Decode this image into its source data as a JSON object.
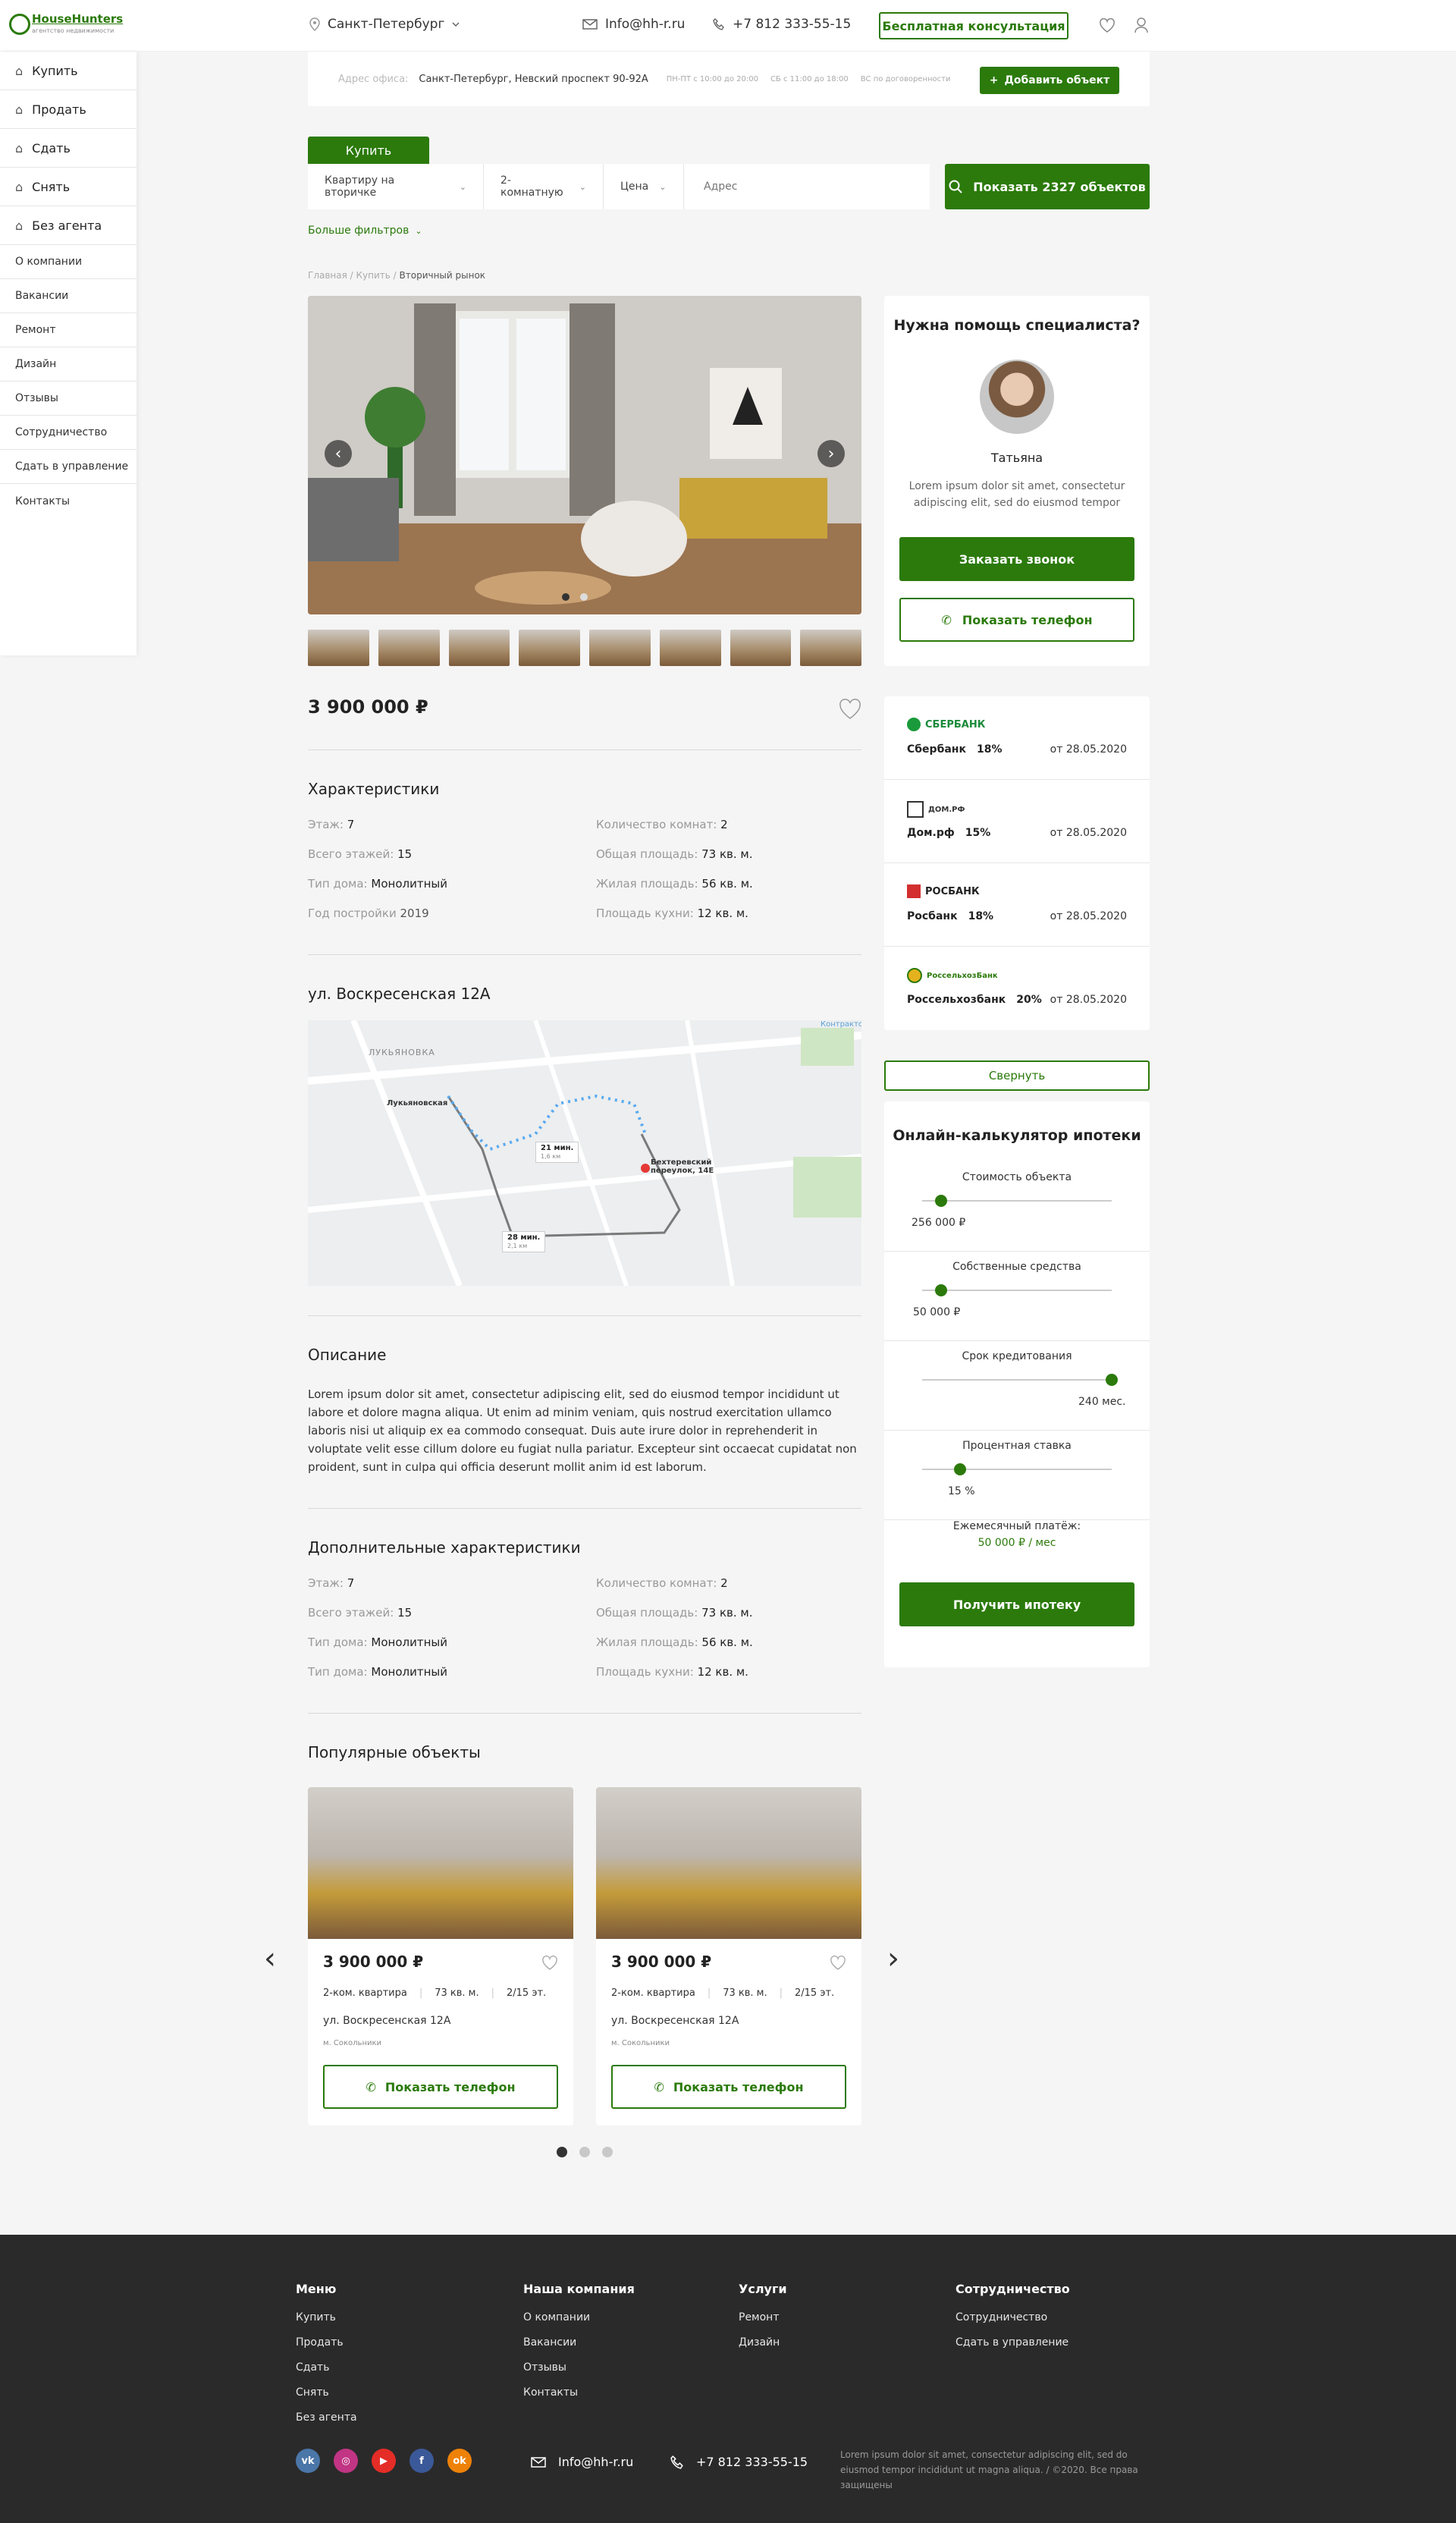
{
  "brand": {
    "name": "HouseHunters",
    "tagline": "агентство недвижимости"
  },
  "header": {
    "city": "Санкт-Петербург",
    "email": "Info@hh-r.ru",
    "phone": "+7 812 333-55-15",
    "consult_button": "Бесплатная консультация"
  },
  "sidebar": {
    "main": [
      {
        "label": "Купить"
      },
      {
        "label": "Продать"
      },
      {
        "label": "Сдать"
      },
      {
        "label": "Снять"
      },
      {
        "label": "Без агента"
      }
    ],
    "sub": [
      {
        "label": "О компании"
      },
      {
        "label": "Вакансии"
      },
      {
        "label": "Ремонт"
      },
      {
        "label": "Дизайн"
      },
      {
        "label": "Отзывы"
      },
      {
        "label": "Сотрудничество"
      },
      {
        "label": "Сдать в управление"
      },
      {
        "label": "Контакты"
      }
    ]
  },
  "office": {
    "label": "Адрес офиса:",
    "address": "Санкт-Петербург, Невский проспект 90-92А",
    "hours": [
      "ПН-ПТ с 10:00 до 20:00",
      "СБ с 11:00 до 18:00",
      "ВС по договоренности"
    ],
    "add_button": "Добавить объект"
  },
  "search": {
    "tab": "Купить",
    "type": "Квартиру на вторичке",
    "rooms": "2-комнатную",
    "price": "Цена",
    "address_placeholder": "Адрес",
    "show_button": "Показать 2327 объектов",
    "more_filters": "Больше фильтров"
  },
  "breadcrumbs": {
    "items": [
      "Главная",
      "Купить"
    ],
    "current": "Вторичный рынок"
  },
  "listing": {
    "price": "3 900 000 ₽",
    "characteristics_title": "Характеристики",
    "characteristics": [
      {
        "k": "Этаж:",
        "v": "7"
      },
      {
        "k": "Количество комнат:",
        "v": "2"
      },
      {
        "k": "Всего этажей:",
        "v": "15"
      },
      {
        "k": "Общая площадь:",
        "v": "73 кв. м."
      },
      {
        "k": "Тип дома:",
        "v": "Монолитный"
      },
      {
        "k": "Жилая площадь:",
        "v": "56 кв. м."
      },
      {
        "k": "Год постройки",
        "v": "2019"
      },
      {
        "k": "Площадь кухни:",
        "v": "12 кв. м."
      }
    ],
    "street_title": "ул. Воскресенская 12А",
    "map": {
      "district": "ЛУКЬЯНОВКА",
      "station": "Лукьяновская",
      "dest": "Бехтеревский переулок, 14Е",
      "route1": "21 мин.",
      "route1_sub": "1,6 км",
      "route2": "28 мин.",
      "route2_sub": "2,1 км",
      "label_kontr": "Контрактова"
    },
    "description_title": "Описание",
    "description": "Lorem ipsum dolor sit amet, consectetur adipiscing elit, sed do eiusmod tempor incididunt ut labore et dolore magna aliqua. Ut enim ad minim veniam, quis nostrud exercitation ullamco laboris nisi ut aliquip ex ea commodo consequat. Duis aute irure dolor in reprehenderit in voluptate velit esse cillum dolore eu fugiat nulla pariatur. Excepteur sint occaecat cupidatat non proident, sunt in culpa qui officia deserunt mollit anim id est laborum.",
    "extra_title": "Дополнительные характеристики",
    "extra": [
      {
        "k": "Этаж:",
        "v": "7"
      },
      {
        "k": "Количество комнат:",
        "v": "2"
      },
      {
        "k": "Всего этажей:",
        "v": "15"
      },
      {
        "k": "Общая площадь:",
        "v": "73 кв. м."
      },
      {
        "k": "Тип дома:",
        "v": "Монолитный"
      },
      {
        "k": "Жилая площадь:",
        "v": "56 кв. м."
      },
      {
        "k": "Тип дома:",
        "v": "Монолитный"
      },
      {
        "k": "Площадь кухни:",
        "v": "12 кв. м."
      }
    ]
  },
  "specialist": {
    "title": "Нужна помощь специалиста?",
    "name": "Татьяна",
    "about": "Lorem ipsum dolor sit amet, consectetur adipiscing elit, sed do eiusmod tempor",
    "call_button": "Заказать звонок",
    "phone_button": "Показать телефон"
  },
  "banks": [
    {
      "logo": "СБЕРБАНК",
      "name": "Сбербанк",
      "rate": "18%",
      "date": "от 28.05.2020"
    },
    {
      "logo": "ДОМ.РФ",
      "name": "Дом.рф",
      "rate": "15%",
      "date": "от 28.05.2020"
    },
    {
      "logo": "РОСБАНК",
      "name": "Росбанк",
      "rate": "18%",
      "date": "от 28.05.2020"
    },
    {
      "logo": "РоссельхозБанк",
      "name": "Россельхозбанк",
      "rate": "20%",
      "date": "от 28.05.2020"
    }
  ],
  "collapse_button": "Свернуть",
  "calculator": {
    "title": "Онлайн-калькулятор ипотеки",
    "sliders": [
      {
        "label": "Стоимость объекта",
        "value": "256 000 ₽",
        "level": 0.1
      },
      {
        "label": "Собственные средства",
        "value": "50 000 ₽",
        "level": 0.1
      },
      {
        "label": "Срок кредитования",
        "value": "240 мес.",
        "level": 1.0
      },
      {
        "label": "Процентная ставка",
        "value": "15 %",
        "level": 0.2
      }
    ],
    "monthly_label": "Ежемесячный платёж:",
    "monthly_value": "50 000 ₽ / мес",
    "get_button": "Получить ипотеку"
  },
  "popular": {
    "title": "Популярные объекты",
    "cards": [
      {
        "price": "3 900 000 ₽",
        "rooms": "2-ком. квартира",
        "area": "73 кв. м.",
        "floor": "2/15 эт.",
        "street": "ул. Воскресенская 12А",
        "metro": "м. Сокольники",
        "button": "Показать телефон"
      },
      {
        "price": "3 900 000 ₽",
        "rooms": "2-ком. квартира",
        "area": "73 кв. м.",
        "floor": "2/15 эт.",
        "street": "ул. Воскресенская 12А",
        "metro": "м. Сокольники",
        "button": "Показать телефон"
      }
    ],
    "page": 1,
    "pages": 3
  },
  "footer": {
    "cols": [
      {
        "title": "Меню",
        "items": [
          "Купить",
          "Продать",
          "Сдать",
          "Снять",
          "Без агента"
        ]
      },
      {
        "title": "Наша компания",
        "items": [
          "О компании",
          "Вакансии",
          "Отзывы",
          "Контакты"
        ]
      },
      {
        "title": "Услуги",
        "items": [
          "Ремонт",
          "Дизайн"
        ]
      },
      {
        "title": "Сотрудничество",
        "items": [
          "Сотрудничество",
          "Сдать в управление"
        ]
      }
    ],
    "email": "Info@hh-r.ru",
    "phone": "+7 812 333-55-15",
    "copyright": "Lorem ipsum dolor sit amet, consectetur adipiscing elit, sed do eiusmod tempor incididunt ut  magna aliqua.  / ©2020. Все права защищены",
    "social": [
      {
        "icon": "vk-icon",
        "glyph": "vk",
        "color": "#4a76a8"
      },
      {
        "icon": "instagram-icon",
        "glyph": "◎",
        "color": "#c13584"
      },
      {
        "icon": "youtube-icon",
        "glyph": "▶",
        "color": "#e52d27"
      },
      {
        "icon": "facebook-icon",
        "glyph": "f",
        "color": "#3b5998"
      },
      {
        "icon": "odnoklassniki-icon",
        "glyph": "ok",
        "color": "#ee8208"
      }
    ]
  },
  "colors": {
    "accent": "#2b7a0b",
    "footer_bg": "#2b2a2a",
    "page_bg": "#f5f5f5"
  }
}
